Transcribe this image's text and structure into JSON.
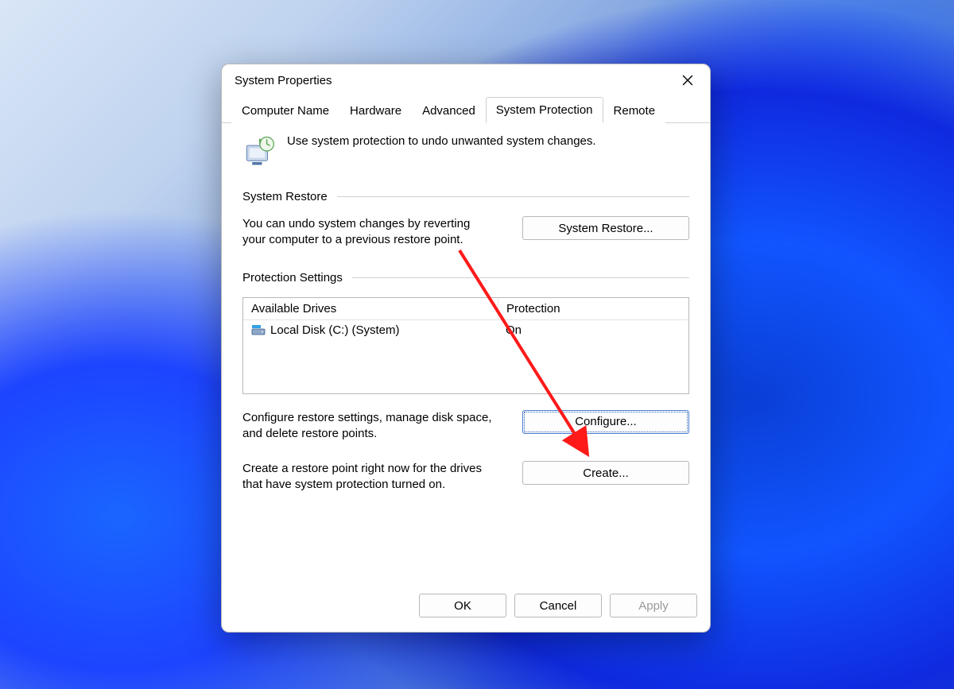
{
  "window": {
    "title": "System Properties"
  },
  "tabs": [
    {
      "label": "Computer Name"
    },
    {
      "label": "Hardware"
    },
    {
      "label": "Advanced"
    },
    {
      "label": "System Protection",
      "active": true
    },
    {
      "label": "Remote"
    }
  ],
  "intro": {
    "text": "Use system protection to undo unwanted system changes."
  },
  "sections": {
    "restore": {
      "title": "System Restore",
      "desc": "You can undo system changes by reverting your computer to a previous restore point.",
      "button": "System Restore..."
    },
    "protection": {
      "title": "Protection Settings",
      "table": {
        "col_drives": "Available Drives",
        "col_protection": "Protection",
        "rows": [
          {
            "name": "Local Disk (C:) (System)",
            "protection": "On"
          }
        ]
      },
      "configure_desc": "Configure restore settings, manage disk space, and delete restore points.",
      "configure_button": "Configure...",
      "create_desc": "Create a restore point right now for the drives that have system protection turned on.",
      "create_button": "Create..."
    }
  },
  "footer": {
    "ok": "OK",
    "cancel": "Cancel",
    "apply": "Apply"
  }
}
